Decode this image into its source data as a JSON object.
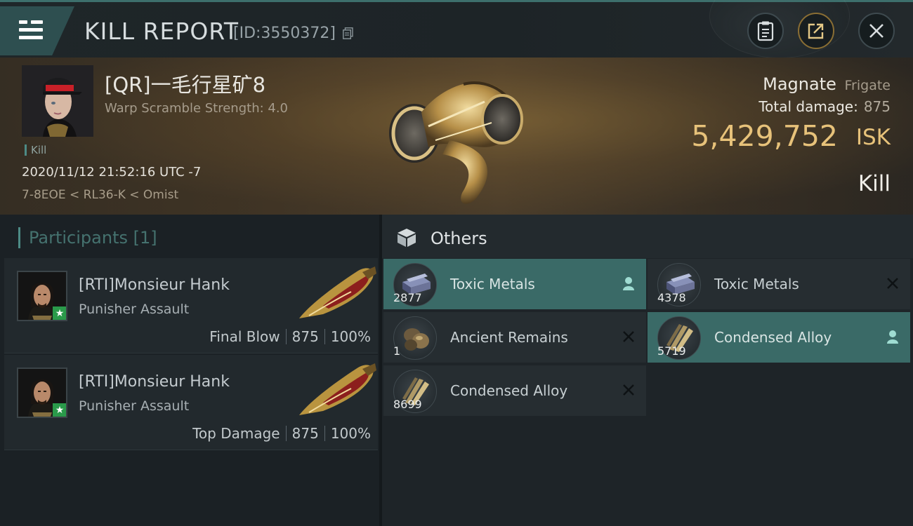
{
  "header": {
    "title": "KILL REPORT",
    "id_label": "[ID:3550372]",
    "icons": [
      "menu-icon",
      "copy-icon",
      "notes-icon",
      "share-icon",
      "close-icon"
    ]
  },
  "victim": {
    "name": "[QR]一毛行星矿8",
    "warp_scramble": "Warp Scramble Strength: 4.0",
    "tag": "Kill",
    "time": "2020/11/12 21:52:16 UTC -7",
    "location": "7-8EOE < RL36-K < Omist",
    "ship_name": "Magnate",
    "ship_class": "Frigate",
    "total_damage_label": "Total damage:",
    "total_damage_value": "875",
    "isk_value": "5,429,752",
    "isk_unit": "ISK",
    "result": "Kill"
  },
  "participants": {
    "title": "Participants [1]",
    "items": [
      {
        "name": "[RTI]Monsieur Hank",
        "ship": "Punisher Assault",
        "role": "Final Blow",
        "damage": "875",
        "percent": "100%"
      },
      {
        "name": "[RTI]Monsieur Hank",
        "ship": "Punisher Assault",
        "role": "Top Damage",
        "damage": "875",
        "percent": "100%"
      }
    ]
  },
  "others": {
    "title": "Others",
    "items": [
      {
        "name": "Toxic Metals",
        "qty": "2877",
        "status": "owned",
        "icon": "toxic-metals-icon"
      },
      {
        "name": "Toxic Metals",
        "qty": "4378",
        "status": "destroyed",
        "icon": "toxic-metals-icon"
      },
      {
        "name": "Ancient Remains",
        "qty": "1",
        "status": "destroyed",
        "icon": "ancient-remains-icon"
      },
      {
        "name": "Condensed Alloy",
        "qty": "5719",
        "status": "owned",
        "icon": "condensed-alloy-icon"
      },
      {
        "name": "Condensed Alloy",
        "qty": "8699",
        "status": "destroyed",
        "icon": "condensed-alloy-icon"
      }
    ]
  },
  "colors": {
    "accent_teal": "#3a6a67",
    "isk_gold": "#e7c27a",
    "header_bg": "#1f2629",
    "panel_bg": "#1e2428"
  }
}
